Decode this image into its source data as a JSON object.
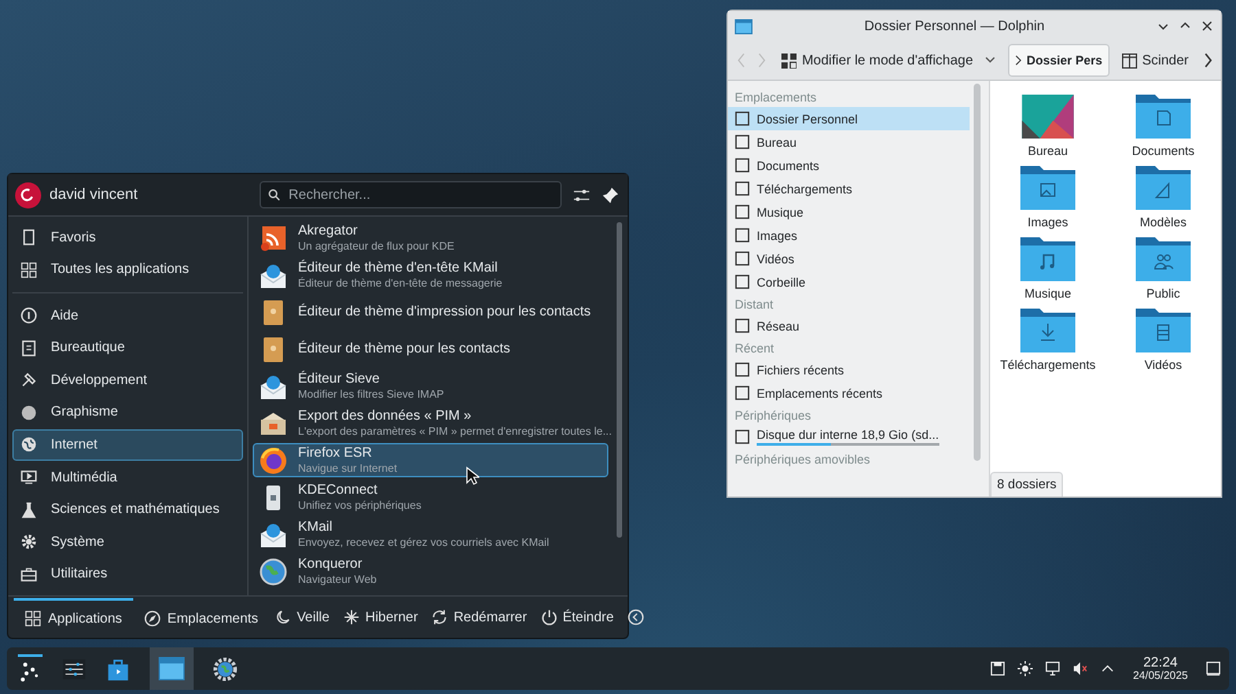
{
  "launcher": {
    "user": "david vincent",
    "search": {
      "placeholder": "Rechercher..."
    },
    "top_items": [
      {
        "label": "Favoris",
        "selected": false
      },
      {
        "label": "Toutes les applications",
        "selected": false
      }
    ],
    "categories": [
      {
        "label": "Aide",
        "selected": false
      },
      {
        "label": "Bureautique",
        "selected": false
      },
      {
        "label": "Développement",
        "selected": false
      },
      {
        "label": "Graphisme",
        "selected": false
      },
      {
        "label": "Internet",
        "selected": true
      },
      {
        "label": "Multimédia",
        "selected": false
      },
      {
        "label": "Sciences et mathématiques",
        "selected": false
      },
      {
        "label": "Système",
        "selected": false
      },
      {
        "label": "Utilitaires",
        "selected": false
      }
    ],
    "apps": [
      {
        "name": "Akregator",
        "description": "Un agrégateur de flux pour KDE",
        "selected": false
      },
      {
        "name": "Éditeur de thème d'en-tête KMail",
        "description": "Éditeur de thème d'en-tête de messagerie",
        "selected": false
      },
      {
        "name": "Éditeur de thème d'impression pour les contacts",
        "selected": false
      },
      {
        "name": "Éditeur de thème pour les contacts",
        "selected": false
      },
      {
        "name": "Éditeur Sieve",
        "description": "Modifier les filtres Sieve IMAP",
        "selected": false
      },
      {
        "name": "Export des données « PIM »",
        "description": "L'export des paramètres « PIM » permet d'enregistrer toutes le...",
        "selected": false
      },
      {
        "name": "Firefox ESR",
        "description": "Navigue sur Internet",
        "selected": true
      },
      {
        "name": "KDEConnect",
        "description": "Unifiez vos périphériques",
        "selected": false
      },
      {
        "name": "KMail",
        "description": "Envoyez, recevez et gérez vos courriels avec KMail",
        "selected": false
      },
      {
        "name": "Konqueror",
        "description": "Navigateur Web",
        "selected": false
      }
    ],
    "tabs": [
      {
        "label": "Applications",
        "selected": true
      },
      {
        "label": "Emplacements",
        "selected": false
      }
    ],
    "power": [
      "Veille",
      "Hiberner",
      "Redémarrer",
      "Éteindre"
    ]
  },
  "dolphin": {
    "title": "Dossier Personnel — Dolphin",
    "toolbar": {
      "view_mode": "Modifier le mode d'affichage",
      "breadcrumb": "Dossier Pers",
      "split": "Scinder"
    },
    "places": [
      {
        "heading": "Emplacements",
        "items": [
          {
            "label": "Dossier Personnel",
            "selected": true
          },
          {
            "label": "Bureau",
            "selected": false
          },
          {
            "label": "Documents",
            "selected": false
          },
          {
            "label": "Téléchargements",
            "selected": false
          },
          {
            "label": "Musique",
            "selected": false
          },
          {
            "label": "Images",
            "selected": false
          },
          {
            "label": "Vidéos",
            "selected": false
          },
          {
            "label": "Corbeille",
            "selected": false
          }
        ]
      },
      {
        "heading": "Distant",
        "items": [
          {
            "label": "Réseau",
            "selected": false
          }
        ]
      },
      {
        "heading": "Récent",
        "items": [
          {
            "label": "Fichiers récents",
            "selected": false
          },
          {
            "label": "Emplacements récents",
            "selected": false
          }
        ]
      },
      {
        "heading": "Périphériques",
        "items": [
          {
            "label": "Disque dur interne 18,9 Gio (sd...",
            "selected": false,
            "level": 0.41
          }
        ]
      },
      {
        "heading": "Périphériques amovibles"
      }
    ],
    "files": [
      "Bureau",
      "Documents",
      "Images",
      "Modèles",
      "Musique",
      "Public",
      "Téléchargements",
      "Vidéos"
    ],
    "status": "8 dossiers"
  },
  "taskbar": {
    "time": "22:24",
    "date": "24/05/2025"
  }
}
